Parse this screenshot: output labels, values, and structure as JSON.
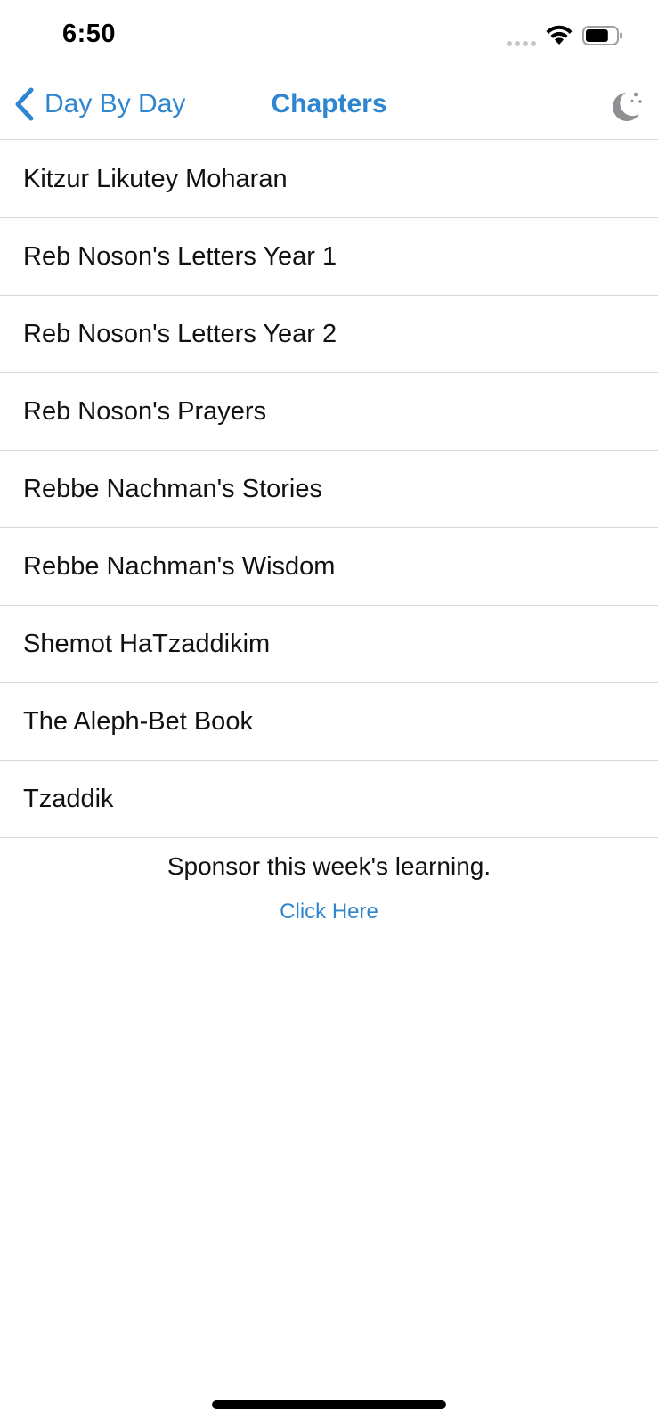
{
  "status_bar": {
    "time": "6:50",
    "icons": [
      "signal-icon",
      "wifi-icon",
      "battery-icon"
    ],
    "battery_level": 0.75
  },
  "nav": {
    "back_label": "Day By Day",
    "title": "Chapters",
    "right_icon": "moon-stars-icon"
  },
  "chapters": [
    "Kitzur Likutey Moharan",
    "Reb Noson's Letters Year 1",
    "Reb Noson's Letters Year 2",
    "Reb Noson's Prayers",
    "Rebbe Nachman's Stories",
    "Rebbe Nachman's Wisdom",
    "Shemot HaTzaddikim",
    "The Aleph-Bet Book",
    "Tzaddik"
  ],
  "sponsor": {
    "text": "Sponsor this week's learning.",
    "link_label": "Click Here"
  },
  "colors": {
    "accent": "#2f86d0",
    "separator": "#d6d6d8",
    "moon": "#8e8e93"
  }
}
